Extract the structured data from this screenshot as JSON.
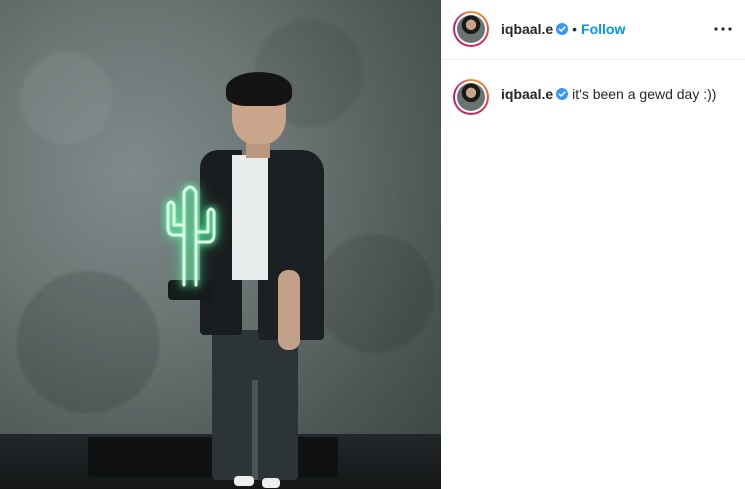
{
  "post": {
    "author": "iqbaal.e",
    "verified": true,
    "follow_label": "Follow",
    "separator": "•",
    "more_icon": "more-horizontal-icon"
  },
  "caption": {
    "username": "iqbaal.e",
    "text": "it's been a gewd day :))"
  },
  "colors": {
    "follow_blue": "#0095f6",
    "verified_blue": "#3897f0",
    "text": "#262626"
  }
}
